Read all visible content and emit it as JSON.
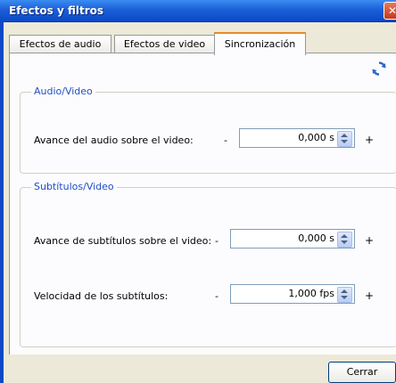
{
  "window": {
    "title": "Efectos y filtros",
    "close_glyph": "✕"
  },
  "tabs": [
    {
      "label": "Efectos de audio"
    },
    {
      "label": "Efectos de video"
    },
    {
      "label": "Sincronización"
    }
  ],
  "groups": {
    "audio_video": {
      "title": "Audio/Video",
      "rows": [
        {
          "label": "Avance del audio sobre el video:",
          "minus": "-",
          "value": "0,000 s",
          "plus": "+"
        }
      ]
    },
    "subtitles_video": {
      "title": "Subtítulos/Video",
      "rows": [
        {
          "label": "Avance de subtítulos sobre el video:",
          "minus": "-",
          "value": "0,000 s",
          "plus": "+"
        },
        {
          "label": "Velocidad de los subtítulos:",
          "minus": "-",
          "value": "1,000 fps",
          "plus": "+"
        }
      ]
    }
  },
  "footer": {
    "close_label": "Cerrar"
  },
  "icons": {
    "refresh": "refresh-icon"
  },
  "colors": {
    "titlebar": "#0b49c6",
    "group_title": "#1f50c7",
    "active_tab_accent": "#e68b2c"
  }
}
